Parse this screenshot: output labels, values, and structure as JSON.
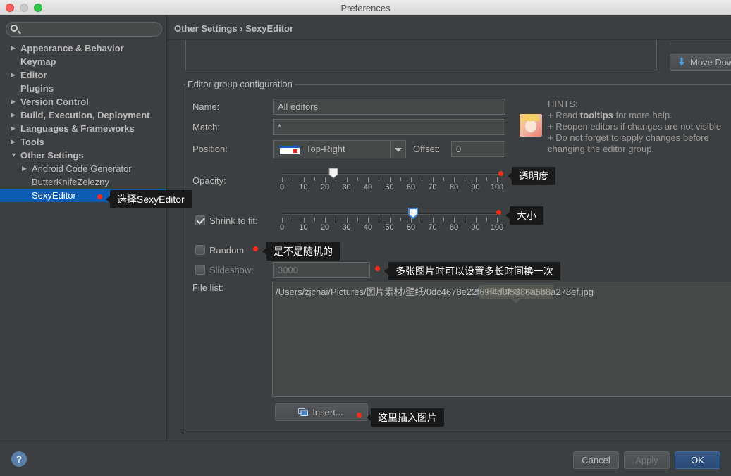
{
  "window": {
    "title": "Preferences"
  },
  "sidebar": {
    "search_placeholder": "",
    "items": [
      {
        "label": "Appearance & Behavior",
        "arrow": "▶"
      },
      {
        "label": "Keymap",
        "arrow": ""
      },
      {
        "label": "Editor",
        "arrow": "▶"
      },
      {
        "label": "Plugins",
        "arrow": ""
      },
      {
        "label": "Version Control",
        "arrow": "▶"
      },
      {
        "label": "Build, Execution, Deployment",
        "arrow": "▶"
      },
      {
        "label": "Languages & Frameworks",
        "arrow": "▶"
      },
      {
        "label": "Tools",
        "arrow": "▶"
      },
      {
        "label": "Other Settings",
        "arrow": "▼"
      },
      {
        "label": "Android Code Generator",
        "arrow": "▶"
      },
      {
        "label": "ButterKnifeZelezny",
        "arrow": ""
      },
      {
        "label": "SexyEditor",
        "arrow": ""
      }
    ]
  },
  "header": {
    "breadcrumb": "Other Settings › SexyEditor"
  },
  "toolbar": {
    "move_down_label": "Move Down"
  },
  "group": {
    "title": "Editor group configuration",
    "name_label": "Name:",
    "name_value": "All editors",
    "match_label": "Match:",
    "match_value": "*",
    "position_label": "Position:",
    "position_value": "Top-Right",
    "offset_label": "Offset:",
    "offset_value": "0",
    "opacity_label": "Opacity:",
    "opacity_value": 24,
    "shrink_label": "Shrink to fit:",
    "shrink_checked": true,
    "shrink_value": 61,
    "slider_ticks": [
      "0",
      "10",
      "20",
      "30",
      "40",
      "50",
      "60",
      "70",
      "80",
      "90",
      "100"
    ],
    "random_label": "Random",
    "random_checked": false,
    "slideshow_label": "Slideshow:",
    "slideshow_checked": false,
    "slideshow_value": "3000",
    "filelist_label": "File list:",
    "filelist_path": "/Users/zjchai/Pictures/图片素材/壁纸/0dc4678e22f69f4d0f5386a5b8a278ef.jpg",
    "filelist_tooltip": "File list of images",
    "insert_label": "Insert..."
  },
  "hints": {
    "title": "HINTS:",
    "line1_pre": "+ Read ",
    "line1_bold": "tooltips",
    "line1_post": " for more help.",
    "line2": "+ Reopen editors if changes are not visible",
    "line3": "+ Do not forget to apply changes before",
    "line4": "changing the editor group."
  },
  "annotations": {
    "select": "选择SexyEditor",
    "opacity": "透明度",
    "size": "大小",
    "random": "是不是随机的",
    "slideshow": "多张图片时可以设置多长时间换一次",
    "insert": "这里插入图片"
  },
  "footer": {
    "help": "?",
    "cancel": "Cancel",
    "apply": "Apply",
    "ok": "OK"
  },
  "colors": {
    "selection": "#0d5bb4",
    "annotation_dot": "#ff2a1a",
    "ok_button": "#2f5280"
  }
}
